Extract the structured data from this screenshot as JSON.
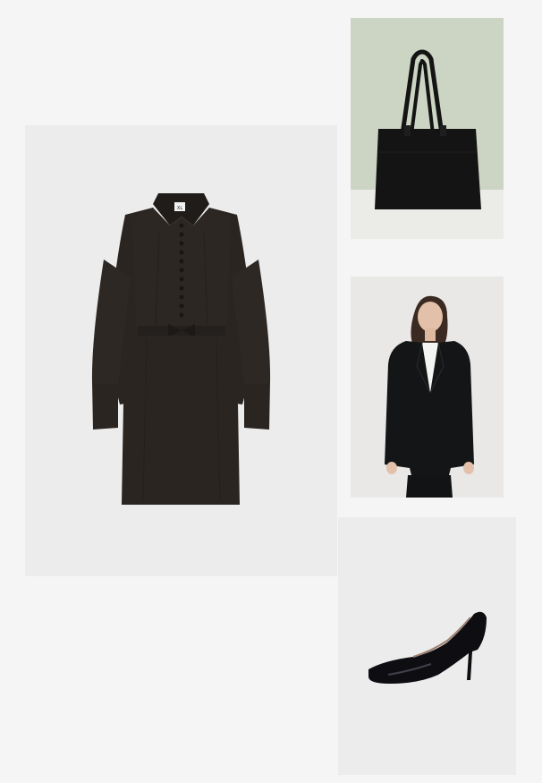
{
  "outfit": {
    "items": [
      {
        "id": "dress",
        "name": "dress-image",
        "color": "#2a2521"
      },
      {
        "id": "bag",
        "name": "tote-bag-image",
        "color": "#141414"
      },
      {
        "id": "blazer",
        "name": "blazer-model-image",
        "color": "#141516"
      },
      {
        "id": "heels",
        "name": "pump-heels-image",
        "color": "#0d0d12"
      }
    ],
    "dress_label_text": "XL"
  }
}
